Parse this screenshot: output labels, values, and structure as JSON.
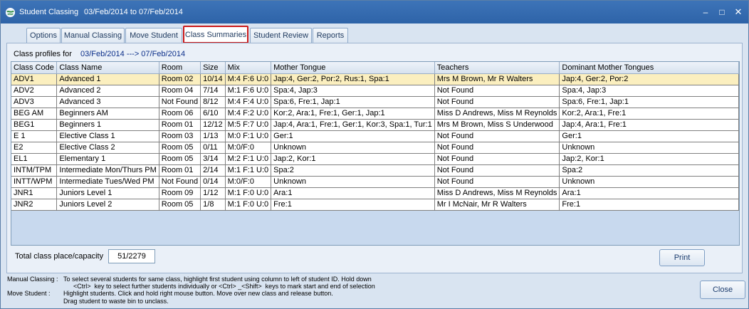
{
  "window": {
    "title": "Student Classing",
    "date_range": "03/Feb/2014 to 07/Feb/2014",
    "controls": {
      "minimize": "–",
      "maximize": "□",
      "close": "✕"
    }
  },
  "tabs": [
    {
      "label": "Options"
    },
    {
      "label": "Manual Classing"
    },
    {
      "label": "Move Student"
    },
    {
      "label": "Class Summaries"
    },
    {
      "label": "Student Review"
    },
    {
      "label": "Reports"
    }
  ],
  "active_tab": "Class Summaries",
  "profiles": {
    "label": "Class profiles for",
    "range": "03/Feb/2014 ---> 07/Feb/2014"
  },
  "table": {
    "columns": [
      "Class Code",
      "Class Name",
      "Room",
      "Size",
      "Mix",
      "Mother Tongue",
      "Teachers",
      "Dominant Mother Tongues"
    ],
    "rows": [
      [
        "ADV1",
        "Advanced 1",
        "Room 02",
        "10/14",
        "M:4 F:6 U:0",
        "Jap:4, Ger:2, Por:2, Rus:1, Spa:1",
        "Mrs M Brown, Mr R Walters",
        "Jap:4, Ger:2, Por:2"
      ],
      [
        "ADV2",
        "Advanced 2",
        "Room 04",
        "7/14",
        "M:1 F:6 U:0",
        "Spa:4, Jap:3",
        "Not Found",
        "Spa:4, Jap:3"
      ],
      [
        "ADV3",
        "Advanced 3",
        "Not Found",
        "8/12",
        "M:4 F:4 U:0",
        "Spa:6, Fre:1, Jap:1",
        "Not Found",
        "Spa:6, Fre:1, Jap:1"
      ],
      [
        "BEG AM",
        "Beginners AM",
        "Room 06",
        "6/10",
        "M:4 F:2 U:0",
        "Kor:2, Ara:1, Fre:1, Ger:1, Jap:1",
        "Miss D Andrews, Miss M Reynolds",
        "Kor:2, Ara:1, Fre:1"
      ],
      [
        "BEG1",
        "Beginners 1",
        "Room 01",
        "12/12",
        "M:5 F:7 U:0",
        "Jap:4, Ara:1, Fre:1, Ger:1, Kor:3, Spa:1, Tur:1",
        "Mrs M Brown, Miss S Underwood",
        "Jap:4, Ara:1, Fre:1"
      ],
      [
        "E 1",
        "Elective Class 1",
        "Room 03",
        "1/13",
        "M:0 F:1 U:0",
        "Ger:1",
        "Not Found",
        "Ger:1"
      ],
      [
        "E2",
        "Elective Class 2",
        "Room 05",
        "0/11",
        "M:0/F:0",
        "Unknown",
        "Not Found",
        "Unknown"
      ],
      [
        "EL1",
        "Elementary 1",
        "Room 05",
        "3/14",
        "M:2 F:1 U:0",
        "Jap:2, Kor:1",
        "Not Found",
        "Jap:2, Kor:1"
      ],
      [
        "INTM/TPM",
        "Intermediate Mon/Thurs PM",
        "Room 01",
        "2/14",
        "M:1 F:1 U:0",
        "Spa:2",
        "Not Found",
        "Spa:2"
      ],
      [
        "INTT/WPM",
        "Intermediate Tues/Wed PM",
        "Not Found",
        "0/14",
        "M:0/F:0",
        "Unknown",
        "Not Found",
        "Unknown"
      ],
      [
        "JNR1",
        "Juniors Level 1",
        "Room 09",
        "1/12",
        "M:1 F:0 U:0",
        "Ara:1",
        "Miss D Andrews, Miss M Reynolds",
        "Ara:1"
      ],
      [
        "JNR2",
        "Juniors Level 2",
        "Room 05",
        "1/8",
        "M:1 F:0 U:0",
        "Fre:1",
        "Mr I McNair, Mr R Walters",
        "Fre:1"
      ]
    ]
  },
  "totals": {
    "label": "Total class place/capacity",
    "value": "51/2279"
  },
  "buttons": {
    "print": "Print",
    "close": "Close"
  },
  "help": {
    "manual_label": "Manual Classing :",
    "manual_line1": "To select several students for same class, highlight first student using column to left of student ID. Hold down",
    "manual_line2": "<Ctrl>  key to select further students individually or <Ctrl> _<Shift>  keys to mark start and end of selection",
    "move_label": "Move Student :",
    "move_line1": "Highlight students. Click and hold right mouse button. Move over new class and release button.",
    "move_line2": "Drag student to waste bin to unclass."
  },
  "colors": {
    "selected_row": "#fbefbf",
    "active_tab_border": "#cc1a1a",
    "titlebar": "#3d74b8"
  }
}
